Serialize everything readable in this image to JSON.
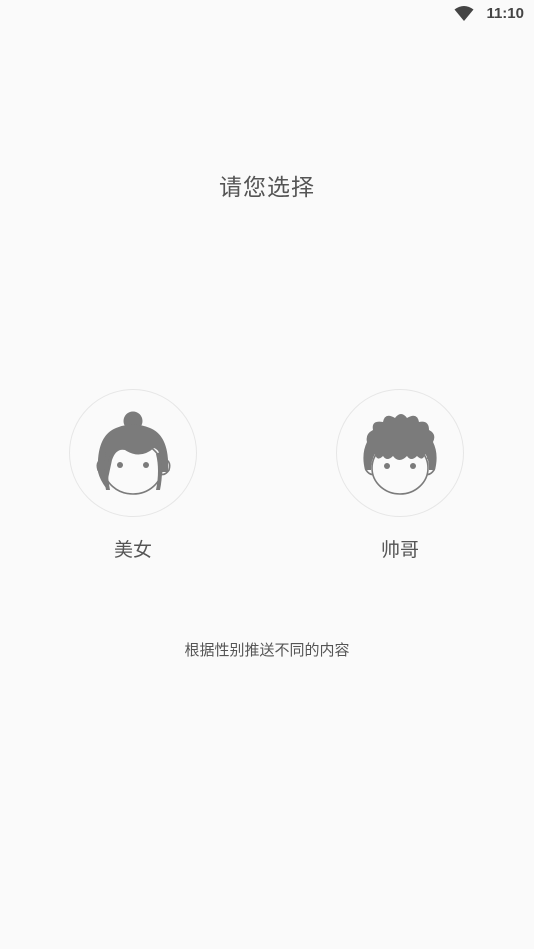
{
  "status_bar": {
    "time": "11:10",
    "wifi_icon": "wifi-icon"
  },
  "title": "请您选择",
  "choices": [
    {
      "id": "female",
      "label": "美女",
      "icon": "female-avatar-icon"
    },
    {
      "id": "male",
      "label": "帅哥",
      "icon": "male-avatar-icon"
    }
  ],
  "hint": "根据性别推送不同的内容",
  "colors": {
    "background": "#fafafa",
    "text": "#555555",
    "avatar_fill": "#7b7b7b",
    "circle_border": "#e6e6e6"
  }
}
